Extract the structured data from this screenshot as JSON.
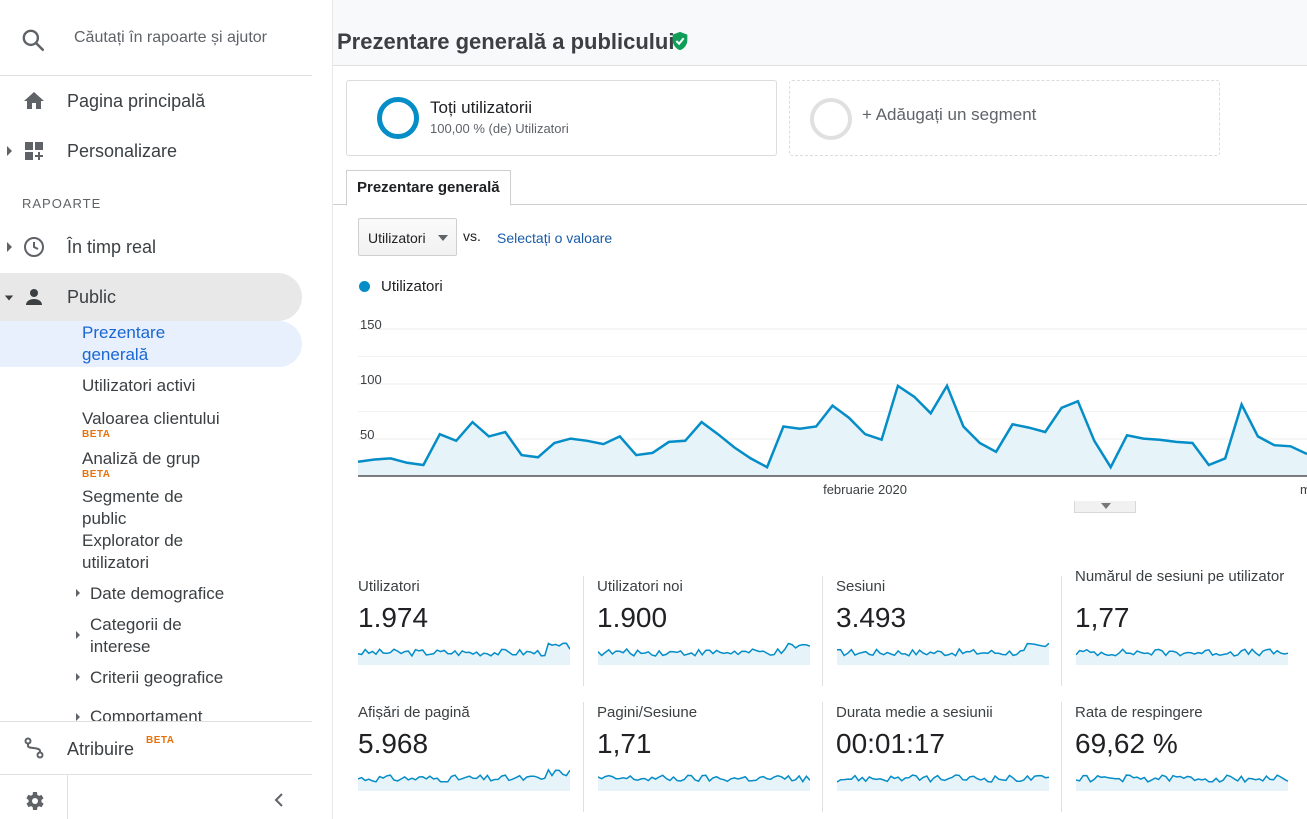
{
  "sidebar": {
    "search_placeholder": "Căutați în rapoarte și ajutor",
    "nav_home": "Pagina principală",
    "nav_customization": "Personalizare",
    "section_reports": "RAPOARTE",
    "nav_realtime": "În timp real",
    "nav_audience": "Public",
    "audience_items": [
      {
        "label": "Prezentare generală",
        "active": true
      },
      {
        "label": "Utilizatori activi"
      },
      {
        "label": "Valoarea clientului",
        "badge": "BETA"
      },
      {
        "label": "Analiză de grup",
        "badge": "BETA"
      },
      {
        "label": "Segmente de public"
      },
      {
        "label": "Explorator de utilizatori"
      }
    ],
    "audience_subgroups": [
      "Date demografice",
      "Categorii de interese",
      "Criterii geografice",
      "Comportament"
    ],
    "nav_attribution": "Atribuire",
    "attribution_badge": "BETA"
  },
  "header": {
    "title": "Prezentare generală a publicului"
  },
  "segments": {
    "all_users_name": "Toți utilizatorii",
    "all_users_sub": "100,00 % (de) Utilizatori",
    "add_segment": "+ Adăugați un segment"
  },
  "tabs": {
    "overview": "Prezentare generală"
  },
  "controls": {
    "metric_select": "Utilizatori",
    "vs_label": "vs.",
    "select_value_link": "Selectați o valoare"
  },
  "chart_data": {
    "type": "area",
    "series": [
      {
        "name": "Utilizatori",
        "values": [
          13,
          15,
          16,
          12,
          10,
          38,
          32,
          49,
          36,
          40,
          19,
          17,
          30,
          34,
          32,
          29,
          36,
          19,
          21,
          31,
          32,
          49,
          38,
          26,
          16,
          8,
          45,
          43,
          45,
          64,
          53,
          38,
          33,
          82,
          72,
          57,
          82,
          45,
          30,
          22,
          47,
          44,
          40,
          62,
          68,
          32,
          8,
          37,
          34,
          33,
          31,
          30,
          10,
          16,
          65,
          36,
          28,
          27,
          20
        ]
      }
    ],
    "y_ticks": [
      50,
      100,
      150
    ],
    "ylim": [
      0,
      160
    ],
    "x_tick_labels": [
      "februarie 2020",
      "m"
    ],
    "color": "#058dc7"
  },
  "metrics": [
    {
      "name": "Utilizatori",
      "value": "1.974"
    },
    {
      "name": "Utilizatori noi",
      "value": "1.900"
    },
    {
      "name": "Sesiuni",
      "value": "3.493"
    },
    {
      "name": "Numărul de sesiuni pe utilizator",
      "value": "1,77"
    },
    {
      "name": "Afișări de pagină",
      "value": "5.968"
    },
    {
      "name": "Pagini/Sesiune",
      "value": "1,71"
    },
    {
      "name": "Durata medie a sesiunii",
      "value": "00:01:17"
    },
    {
      "name": "Rata de respingere",
      "value": "69,62 %"
    }
  ],
  "colors": {
    "accent_blue": "#058dc7",
    "active_link": "#1967d2",
    "beta_orange": "#e8710a",
    "verified_green": "#0f9d58"
  }
}
